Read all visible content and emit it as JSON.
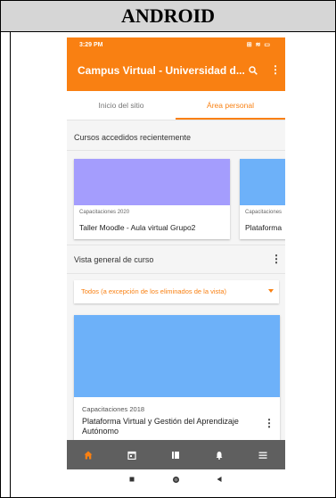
{
  "doc": {
    "header": "ANDROID"
  },
  "statusbar": {
    "time": "3:29 PM",
    "icons": "⊞ ≋ ▭"
  },
  "appbar": {
    "title": "Campus Virtual - Universidad d...",
    "more": "⋮"
  },
  "tabs": [
    {
      "label": "Inicio del sitio",
      "active": false
    },
    {
      "label": "Área personal",
      "active": true
    }
  ],
  "recent": {
    "title": "Cursos accedidos recientemente",
    "courses": [
      {
        "category": "Capacitaciones 2020",
        "name": "Taller Moodle - Aula virtual Grupo2",
        "color": "#a49dfd"
      },
      {
        "category": "Capacitaciones",
        "name": "Plataforma",
        "color": "#6db1f9"
      }
    ]
  },
  "overview": {
    "title": "Vista general de curso",
    "more": "⋮",
    "filter": "Todos (a excepción de los eliminados de la vista)",
    "course": {
      "category": "Capacitaciones 2018",
      "name": "Plataforma Virtual y Gestión del Aprendizaje Autónomo",
      "color": "#6db1f9",
      "more": "⋮"
    }
  },
  "bottomnav": [
    "home-icon",
    "calendar-icon",
    "courses-icon",
    "notifications-icon",
    "menu-icon"
  ],
  "colors": {
    "accent": "#f98012",
    "nav_bg": "#5f5f5f"
  }
}
